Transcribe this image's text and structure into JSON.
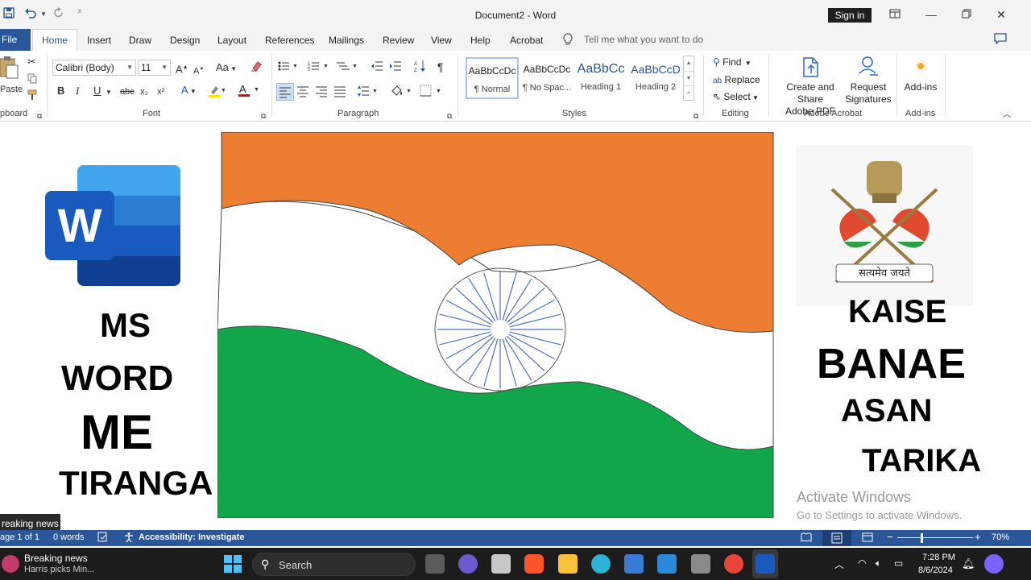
{
  "titlebar": {
    "doc_title": "Document2  -  Word",
    "sign_in": "Sign in",
    "qa_icons": [
      "save-icon",
      "undo-icon",
      "redo-icon",
      "customize-icon"
    ]
  },
  "tabs": {
    "file": "File",
    "home": "Home",
    "insert": "Insert",
    "draw": "Draw",
    "design": "Design",
    "layout": "Layout",
    "references": "References",
    "mailings": "Mailings",
    "review": "Review",
    "view": "View",
    "help": "Help",
    "acrobat": "Acrobat",
    "tell_me": "Tell me what you want to do"
  },
  "ribbon": {
    "clipboard": {
      "paste": "Paste",
      "label": "pboard"
    },
    "font": {
      "name": "Calibri (Body)",
      "size": "11",
      "change_case": "Aa",
      "bold": "B",
      "italic": "I",
      "underline": "U",
      "strike": "abc",
      "subscript": "x₂",
      "superscript": "x²",
      "label": "Font"
    },
    "paragraph": {
      "label": "Paragraph"
    },
    "styles": {
      "items": [
        {
          "sample": "AaBbCcDc",
          "name": "¶ Normal"
        },
        {
          "sample": "AaBbCcDc",
          "name": "¶ No Spac..."
        },
        {
          "sample": "AaBbCc",
          "name": "Heading 1"
        },
        {
          "sample": "AaBbCcD",
          "name": "Heading 2"
        }
      ],
      "label": "Styles"
    },
    "editing": {
      "find": "Find",
      "replace": "Replace",
      "select": "Select",
      "label": "Editing"
    },
    "acrobat": {
      "create_share_1": "Create and Share",
      "create_share_2": "Adobe PDF",
      "request_1": "Request",
      "request_2": "Signatures",
      "label": "Adobe Acrobat"
    },
    "addins": {
      "button": "Add-ins",
      "label": "Add-ins"
    }
  },
  "document": {
    "left_text": [
      "MS",
      "WORD",
      "ME",
      "TIRANGA"
    ],
    "right_text": [
      "KAISE",
      "BANAE",
      "ASAN",
      "TARIKA"
    ],
    "emblem_motto": "सत्यमेव जयते",
    "word_logo_letter": "W",
    "flag_colors": {
      "saffron": "#ed7d31",
      "white": "#ffffff",
      "green": "#12a64a",
      "chakra": "#4f72b8"
    },
    "activate_title": "Activate Windows",
    "activate_sub": "Go to Settings to activate Windows."
  },
  "tooltip": {
    "text": "reaking news"
  },
  "statusbar": {
    "page": "age 1 of 1",
    "words": "0 words",
    "accessibility": "Accessibility: Investigate",
    "zoom": "70%"
  },
  "taskbar": {
    "news_title": "Breaking news",
    "news_sub": "Harris picks Min...",
    "search": "Search",
    "time": "7:28 PM",
    "date": "8/6/2024"
  }
}
